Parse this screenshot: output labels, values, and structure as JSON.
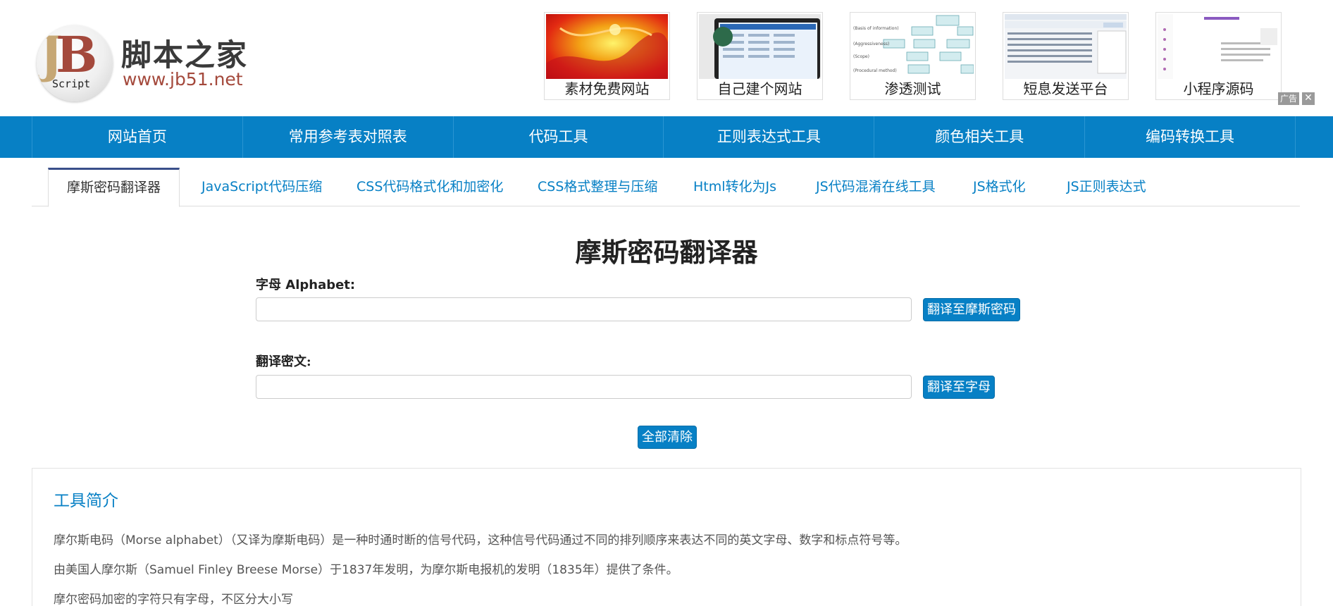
{
  "site": {
    "name": "脚本之家",
    "url": "www.jb51.net",
    "logo_script": "Script"
  },
  "ads": [
    {
      "label": "素材免费网站"
    },
    {
      "label": "自己建个网站"
    },
    {
      "label": "渗透测试"
    },
    {
      "label": "短息发送平台"
    },
    {
      "label": "小程序源码"
    }
  ],
  "ad_badge": "广告",
  "ad_close": "✕",
  "nav": [
    "网站首页",
    "常用参考表对照表",
    "代码工具",
    "正则表达式工具",
    "颜色相关工具",
    "编码转换工具"
  ],
  "tabs": [
    "摩斯密码翻译器",
    "JavaScript代码压缩",
    "CSS代码格式化和加密化",
    "CSS格式整理与压缩",
    "Html转化为Js",
    "JS代码混淆在线工具",
    "JS格式化",
    "JS正则表达式"
  ],
  "main": {
    "title": "摩斯密码翻译器",
    "alphabet_label": "字母 Alphabet:",
    "alphabet_value": "",
    "to_morse_button": "翻译至摩斯密码",
    "cipher_label": "翻译密文:",
    "cipher_value": "",
    "to_alpha_button": "翻译至字母",
    "clear_button": "全部清除"
  },
  "intro": {
    "title": "工具简介",
    "paragraphs": [
      "摩尔斯电码（Morse alphabet）（又译为摩斯电码）是一种时通时断的信号代码，这种信号代码通过不同的排列顺序来表达不同的英文字母、数字和标点符号等。",
      "由美国人摩尔斯（Samuel Finley Breese Morse）于1837年发明，为摩尔斯电报机的发明（1835年）提供了条件。",
      "摩尔密码加密的字符只有字母，不区分大小写"
    ]
  },
  "colors": {
    "brand_blue": "#0780c5",
    "logo_red": "#a4493c"
  }
}
